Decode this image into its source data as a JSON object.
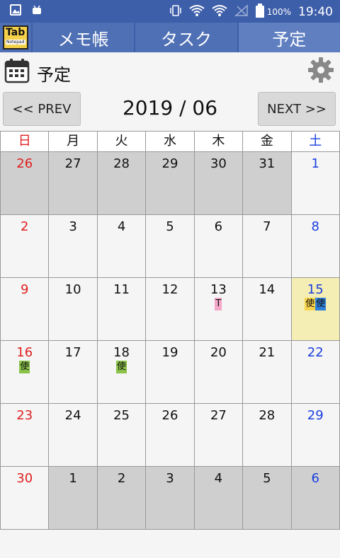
{
  "status_bar": {
    "battery_pct": "100%",
    "time": "19:40"
  },
  "app": {
    "logo_text": "Tab",
    "logo_sub": "Notepad"
  },
  "tabs": [
    {
      "label": "メモ帳"
    },
    {
      "label": "タスク"
    },
    {
      "label": "予定"
    }
  ],
  "header": {
    "title": "予定"
  },
  "nav": {
    "prev": "<< PREV",
    "next": "NEXT >>",
    "month": "2019 / 06"
  },
  "weekdays": [
    "日",
    "月",
    "火",
    "水",
    "木",
    "金",
    "土"
  ],
  "weeks": [
    [
      {
        "d": "26",
        "o": true
      },
      {
        "d": "27",
        "o": true
      },
      {
        "d": "28",
        "o": true
      },
      {
        "d": "29",
        "o": true
      },
      {
        "d": "30",
        "o": true
      },
      {
        "d": "31",
        "o": true
      },
      {
        "d": "1"
      }
    ],
    [
      {
        "d": "2"
      },
      {
        "d": "3"
      },
      {
        "d": "4"
      },
      {
        "d": "5"
      },
      {
        "d": "6"
      },
      {
        "d": "7"
      },
      {
        "d": "8"
      }
    ],
    [
      {
        "d": "9"
      },
      {
        "d": "10"
      },
      {
        "d": "11"
      },
      {
        "d": "12"
      },
      {
        "d": "13",
        "tags": [
          {
            "t": "T",
            "c": "pink"
          }
        ]
      },
      {
        "d": "14"
      },
      {
        "d": "15",
        "today": true,
        "tags": [
          {
            "t": "使",
            "c": "yellow"
          },
          {
            "t": "使",
            "c": "bluebg"
          }
        ]
      }
    ],
    [
      {
        "d": "16",
        "tags": [
          {
            "t": "使",
            "c": "green"
          }
        ]
      },
      {
        "d": "17"
      },
      {
        "d": "18",
        "tags": [
          {
            "t": "使",
            "c": "green"
          }
        ]
      },
      {
        "d": "19"
      },
      {
        "d": "20"
      },
      {
        "d": "21"
      },
      {
        "d": "22"
      }
    ],
    [
      {
        "d": "23"
      },
      {
        "d": "24"
      },
      {
        "d": "25"
      },
      {
        "d": "26"
      },
      {
        "d": "27"
      },
      {
        "d": "28"
      },
      {
        "d": "29"
      }
    ],
    [
      {
        "d": "30"
      },
      {
        "d": "1",
        "o": true
      },
      {
        "d": "2",
        "o": true
      },
      {
        "d": "3",
        "o": true
      },
      {
        "d": "4",
        "o": true
      },
      {
        "d": "5",
        "o": true
      },
      {
        "d": "6",
        "o": true
      }
    ]
  ]
}
